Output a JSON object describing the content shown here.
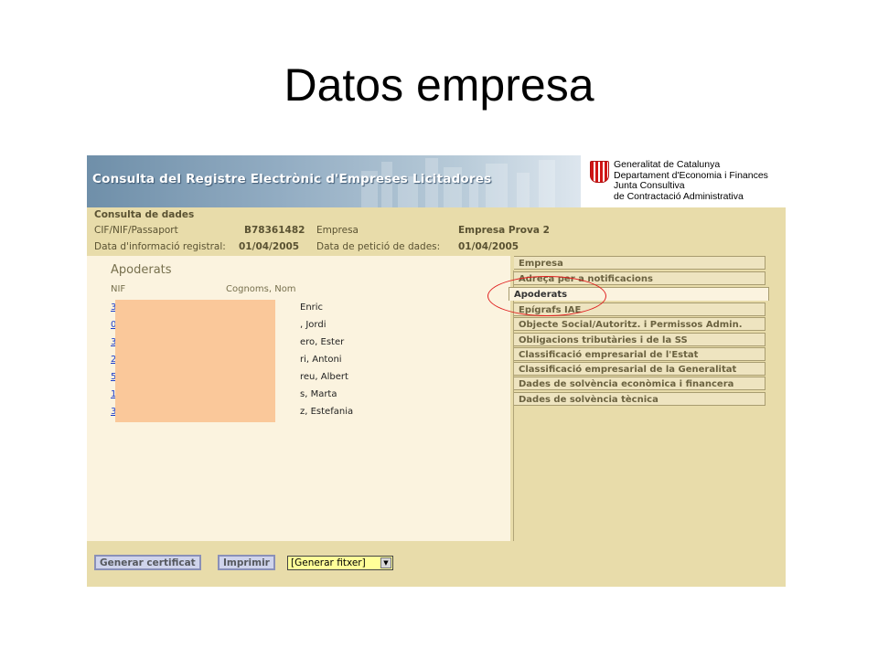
{
  "slide": {
    "title": "Datos empresa"
  },
  "banner": {
    "app_title": "Consulta del Registre Electrònic d'Empreses Licitadores",
    "org_lines": [
      "Generalitat de Catalunya",
      "Departament d'Economia i Finances",
      "Junta Consultiva",
      "de Contractació Administrativa"
    ]
  },
  "header": {
    "section_title": "Consulta de dades",
    "cif_label": "CIF/NIF/Passaport",
    "cif_value": "B78361482",
    "empresa_label": "Empresa",
    "empresa_value": "Empresa Prova 2",
    "data_info_label": "Data d'informació registral:",
    "data_info_value": "01/04/2005",
    "data_peticio_label": "Data de petició de dades:",
    "data_peticio_value": "01/04/2005"
  },
  "apoderats": {
    "title": "Apoderats",
    "columns": [
      "NIF",
      "Cognoms, Nom"
    ],
    "rows": [
      {
        "nif": "3",
        "name": "Enric"
      },
      {
        "nif": "0",
        "name": ", Jordi"
      },
      {
        "nif": "3",
        "name": "ero, Ester"
      },
      {
        "nif": "2",
        "name": "ri, Antoni"
      },
      {
        "nif": "5",
        "name": "reu, Albert"
      },
      {
        "nif": "1",
        "name": "s, Marta"
      },
      {
        "nif": "3",
        "name": "z, Estefania"
      }
    ]
  },
  "tabs": [
    "Empresa",
    "Adreça per a notificacions",
    "Apoderats",
    "Epígrafs IAE",
    "Objecte Social/Autoritz. i Permissos Admin.",
    "Obligacions tributàries i de la SS",
    "Classificació empresarial de l'Estat",
    "Classificació empresarial de la Generalitat",
    "Dades de solvència econòmica i financera",
    "Dades de solvència tècnica"
  ],
  "active_tab": "Apoderats",
  "toolbar": {
    "generar_certificat": "Generar certificat",
    "imprimir": "Imprimir",
    "generar_fitxer": "[Generar fitxer]"
  },
  "colors": {
    "background": "#e8dcaa",
    "panel": "#fbf3df",
    "redaction": "#fac89a",
    "highlight_circle": "#e02020",
    "link": "#1e3ec8"
  }
}
